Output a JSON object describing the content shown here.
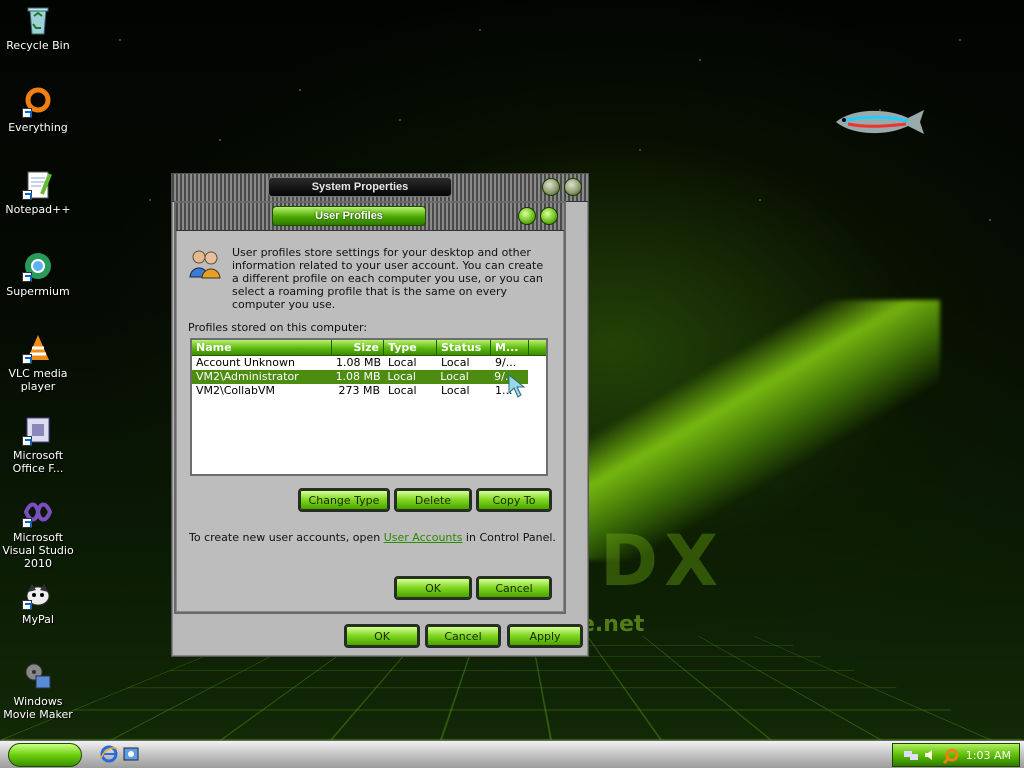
{
  "desktop": {
    "icons": [
      {
        "label": "Recycle Bin",
        "icon": "recycle-bin-icon"
      },
      {
        "label": "Everything",
        "icon": "everything-icon"
      },
      {
        "label": "Notepad++",
        "icon": "notepad-plus-plus-icon"
      },
      {
        "label": "Supermium",
        "icon": "supermium-icon"
      },
      {
        "label": "VLC media player",
        "icon": "vlc-icon"
      },
      {
        "label": "Microsoft Office F...",
        "icon": "office-icon"
      },
      {
        "label": "Microsoft Visual Studio 2010",
        "icon": "visual-studio-icon"
      },
      {
        "label": "MyPal",
        "icon": "mypal-icon"
      },
      {
        "label": "Windows Movie Maker",
        "icon": "movie-maker-icon"
      }
    ],
    "wallpaper_text": "e.net",
    "wallpaper_logo": "DX"
  },
  "system_properties": {
    "title": "System Properties",
    "ok_label": "OK",
    "cancel_label": "Cancel",
    "apply_label": "Apply"
  },
  "user_profiles": {
    "title": "User Profiles",
    "description": "User profiles store settings for your desktop and other information related to your user account. You can create a different profile on each computer you use, or you can select a roaming profile that is the same on every computer you use.",
    "list_label": "Profiles stored on this computer:",
    "columns": [
      "Name",
      "Size",
      "Type",
      "Status",
      "M..."
    ],
    "rows": [
      {
        "name": "Account Unknown",
        "size": "1.08 MB",
        "type": "Local",
        "status": "Local",
        "modified": "9/..."
      },
      {
        "name": "VM2\\Administrator",
        "size": "1.08 MB",
        "type": "Local",
        "status": "Local",
        "modified": "9/..."
      },
      {
        "name": "VM2\\CollabVM",
        "size": "273 MB",
        "type": "Local",
        "status": "Local",
        "modified": "1..."
      }
    ],
    "selected_row": 1,
    "change_type_label": "Change Type",
    "delete_label": "Delete",
    "copy_to_label": "Copy To",
    "footer_prefix": "To create new user accounts, open ",
    "footer_link": "User Accounts",
    "footer_suffix": " in Control Panel.",
    "ok_label": "OK",
    "cancel_label": "Cancel"
  },
  "taskbar": {
    "clock": "1:03 AM",
    "quick_launch": [
      "internet-explorer-icon",
      "show-desktop-icon"
    ]
  },
  "colors": {
    "accent": "#5db80e",
    "selection": "#4c8c10",
    "link": "#2a8a00"
  }
}
